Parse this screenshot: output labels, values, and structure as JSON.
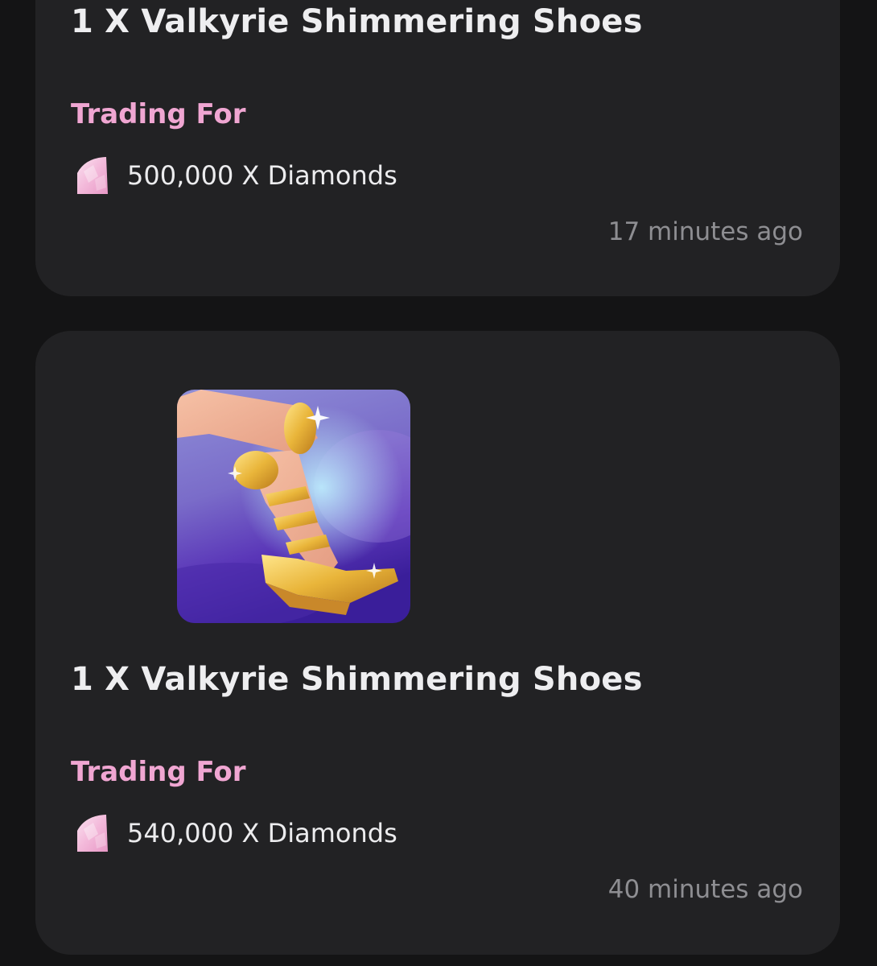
{
  "listings": [
    {
      "title": "1 X Valkyrie Shimmering Shoes",
      "trading_label": "Trading For",
      "price": "500,000 X Diamonds",
      "price_icon": "diamond-icon",
      "time": "17 minutes ago"
    },
    {
      "title": "1 X Valkyrie Shimmering Shoes",
      "trading_label": "Trading For",
      "price": "540,000 X Diamonds",
      "price_icon": "diamond-icon",
      "time": "40 minutes ago",
      "image": "valkyrie-shimmering-shoes-image"
    }
  ],
  "colors": {
    "background": "#141415",
    "card": "#222224",
    "accent_pink": "#f0a6d2",
    "title_text": "#eeeef0",
    "timestamp_text": "#8e8e92"
  }
}
